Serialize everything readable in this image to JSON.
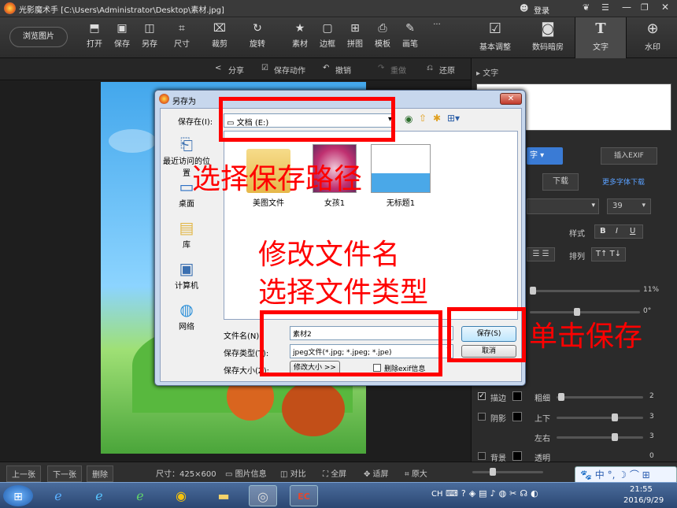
{
  "window": {
    "title": "光影魔术手 [C:\\Users\\Administrator\\Desktop\\素材.jpg]",
    "login": "登录"
  },
  "toolbar": {
    "browse": "浏览图片",
    "tools": [
      {
        "label": "打开",
        "icon": "open-icon"
      },
      {
        "label": "保存",
        "icon": "save-icon"
      },
      {
        "label": "另存",
        "icon": "save-as-icon"
      },
      {
        "label": "尺寸",
        "icon": "resize-icon"
      },
      {
        "label": "裁剪",
        "icon": "crop-icon"
      },
      {
        "label": "旋转",
        "icon": "rotate-icon"
      },
      {
        "label": "素材",
        "icon": "material-icon"
      },
      {
        "label": "边框",
        "icon": "border-icon"
      },
      {
        "label": "拼图",
        "icon": "collage-icon"
      },
      {
        "label": "模板",
        "icon": "template-icon"
      },
      {
        "label": "画笔",
        "icon": "brush-icon"
      }
    ],
    "more": "···",
    "right_tabs": [
      {
        "label": "基本调整",
        "icon": "adjust-icon"
      },
      {
        "label": "数码暗房",
        "icon": "darkroom-icon"
      },
      {
        "label": "文字",
        "icon": "text-icon"
      },
      {
        "label": "水印",
        "icon": "watermark-icon"
      }
    ]
  },
  "subbar": {
    "share": "分享",
    "batch": "保存动作",
    "undo": "撤销",
    "redo": "重做",
    "restore": "还原"
  },
  "right_panel": {
    "section": "文字",
    "insert_exif": "插入EXIF",
    "font_mode": "字",
    "download": "下载",
    "more_fonts": "更多字体下载",
    "font_size": "39",
    "style_label": "样式",
    "style_b": "B",
    "style_i": "I",
    "style_u": "U",
    "arrange_label": "排列",
    "transparency": "11%",
    "rotation": "0°",
    "stroke": "描边",
    "shadow": "阴影",
    "background": "背景",
    "thickness": "粗细",
    "up_down": "上下",
    "left_right": "左右",
    "opacity": "透明",
    "v_thickness": "2",
    "v_updown": "3",
    "v_leftright": "3",
    "v_opacity": "0"
  },
  "bottombar": {
    "prev": "上一张",
    "next": "下一张",
    "delete": "删除",
    "size": "尺寸：425×600",
    "info": "图片信息",
    "compare": "对比",
    "fullscreen": "全屏",
    "fit": "适屏",
    "original": "原大"
  },
  "taskbar": {
    "time": "21:55",
    "date": "2016/9/29",
    "lang": "CH"
  },
  "dialog": {
    "title": "另存为",
    "save_in_label": "保存在(I):",
    "save_in_value": "文档 (E:)",
    "places": [
      "最近访问的位置",
      "桌面",
      "库",
      "计算机",
      "网络"
    ],
    "files": [
      "美图文件",
      "女孩1",
      "无标题1"
    ],
    "filename_label": "文件名(N):",
    "filename_value": "素材2",
    "filetype_label": "保存类型(T):",
    "filetype_value": "jpeg文件(*.jpg; *.jpeg; *.jpe)",
    "size_label": "保存大小(Z):",
    "modify_size": "修改大小 >>",
    "delete_exif": "删除exif信息",
    "save_button": "保存(S)",
    "cancel_button": "取消"
  },
  "annotations": {
    "path": "选择保存路径",
    "rename": "修改文件名",
    "filetype": "选择文件类型",
    "click_save": "单击保存"
  },
  "ime": {
    "label": "中"
  }
}
